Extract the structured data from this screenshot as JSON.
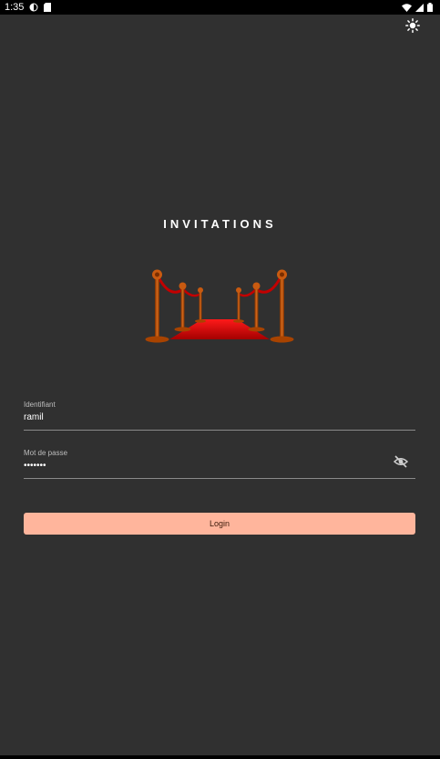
{
  "status_bar": {
    "time": "1:35",
    "icons": [
      "data-saver-icon",
      "sd-card-icon",
      "wifi-icon",
      "signal-icon",
      "battery-icon"
    ]
  },
  "header": {
    "theme_icon": "sun-icon"
  },
  "app": {
    "title": "INVITATIONS",
    "logo": "red-carpet-logo"
  },
  "login_form": {
    "username": {
      "label": "Identifiant",
      "value": "ramil"
    },
    "password": {
      "label": "Mot de passe",
      "value": "•••••••",
      "toggle_icon": "visibility-off-icon"
    },
    "submit_label": "Login"
  },
  "colors": {
    "background": "#303030",
    "accent": "#ffb59c",
    "carpet": "#d10000",
    "post": "#b54a00"
  }
}
